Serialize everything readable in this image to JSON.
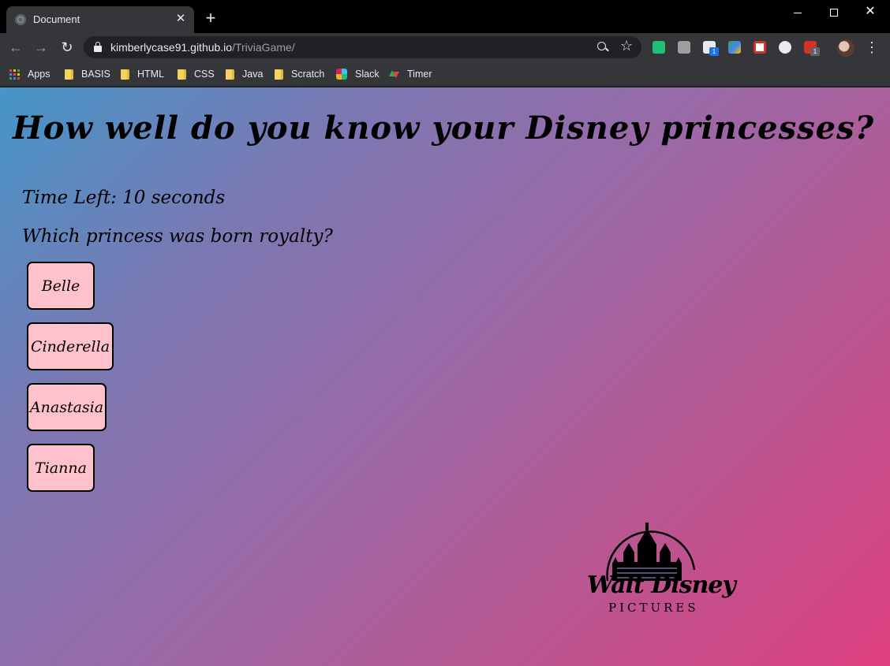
{
  "browser": {
    "tab_title": "Document",
    "url_host": "kimberlycase91.github.io",
    "url_path": "/TriviaGame/",
    "bookmarks": [
      "Apps",
      "BASIS",
      "HTML",
      "CSS",
      "Java",
      "Scratch",
      "Slack",
      "Timer"
    ],
    "extension_badges": [
      "1",
      "1"
    ]
  },
  "page": {
    "title": "How well do you know your Disney princesses?",
    "timer_text": "Time Left: 10 seconds",
    "question": "Which princess was born royalty?",
    "answers": [
      "Belle",
      "Cinderella",
      "Anastasia",
      "Tianna"
    ]
  },
  "logo": {
    "script_text": "Walt Disney",
    "subtitle": "PICTURES"
  },
  "colors": {
    "gradient_start": "#4596c8",
    "gradient_end": "#de3f80",
    "answer_button_bg": "#ffc1cb"
  }
}
